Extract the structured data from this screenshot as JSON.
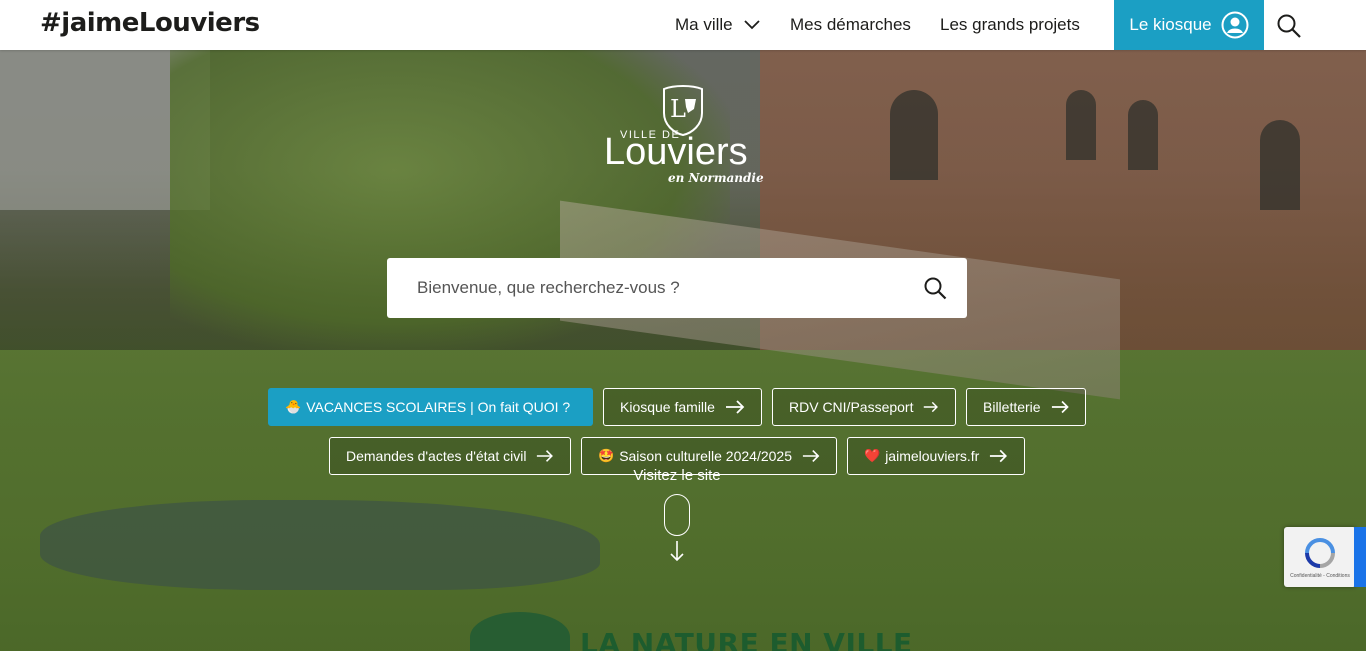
{
  "header": {
    "brand": "#jaimeLouviers",
    "nav": [
      {
        "label": "Ma ville"
      },
      {
        "label": "Mes démarches"
      },
      {
        "label": "Les grands projets"
      }
    ],
    "kiosque_label": "Le kiosque",
    "accent": "#1b9fc4"
  },
  "logo": {
    "ville": "VILLE DE",
    "city": "Louviers",
    "region": "en Normandie"
  },
  "search": {
    "placeholder": "Bienvenue, que recherchez-vous ?"
  },
  "quick_links": [
    {
      "emoji": "🐣",
      "label": "VACANCES SCOLAIRES | On fait QUOI ?"
    },
    {
      "label": "Kiosque famille"
    },
    {
      "label": "RDV CNI/Passeport"
    },
    {
      "label": "Billetterie"
    },
    {
      "label": "Demandes d'actes d'état civil"
    },
    {
      "emoji": "🤩",
      "label": "Saison culturelle 2024/2025"
    },
    {
      "emoji": "❤️",
      "label": "jaimelouviers.fr"
    }
  ],
  "visit_label": "Visitez le site",
  "banner": "LA NATURE EN VILLE",
  "recaptcha": {
    "terms": "Confidentialité - Conditions"
  }
}
